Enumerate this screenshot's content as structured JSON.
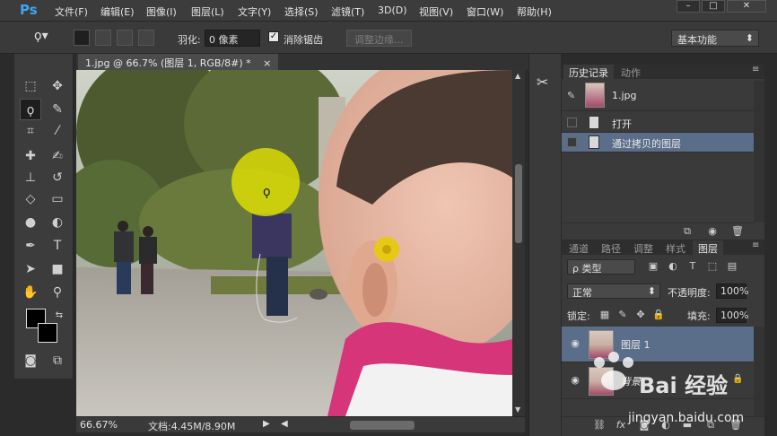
{
  "app": {
    "logo": "Ps",
    "menu": [
      "文件(F)",
      "编辑(E)",
      "图像(I)",
      "图层(L)",
      "文字(Y)",
      "选择(S)",
      "滤镜(T)",
      "3D(D)",
      "视图(V)",
      "窗口(W)",
      "帮助(H)"
    ],
    "window_buttons": [
      "–",
      "□",
      "✕"
    ]
  },
  "options": {
    "feather_label": "羽化:",
    "feather_value": "0 像素",
    "antialias_label": "消除锯齿",
    "antialias_checked": "✓",
    "refine_edge": "调整边缘...",
    "workspace": "基本功能"
  },
  "document": {
    "tab_title": "1.jpg @ 66.7% (图层 1, RGB/8#) *",
    "tab_close": "×",
    "zoom": "66.67%",
    "doc_info": "文档:4.45M/8.90M"
  },
  "history_panel": {
    "tabs": [
      "历史记录",
      "动作"
    ],
    "snapshot_label": "1.jpg",
    "steps": [
      "打开",
      "通过拷贝的图层"
    ]
  },
  "layers_panel": {
    "tabs": [
      "通道",
      "路径",
      "调整",
      "样式",
      "图层"
    ],
    "filter_kind": "ρ 类型",
    "blend_mode": "正常",
    "opacity_label": "不透明度:",
    "opacity_value": "100%",
    "lock_label": "锁定:",
    "fill_label": "填充:",
    "fill_value": "100%",
    "layers": [
      "图层 1",
      "背景"
    ]
  },
  "watermark": {
    "brand": "Bai 经验",
    "url": "jingyan.baidu.com"
  },
  "colors": {
    "selection_highlight": "#5a6e8a",
    "brush_cursor": "#e6e600"
  }
}
